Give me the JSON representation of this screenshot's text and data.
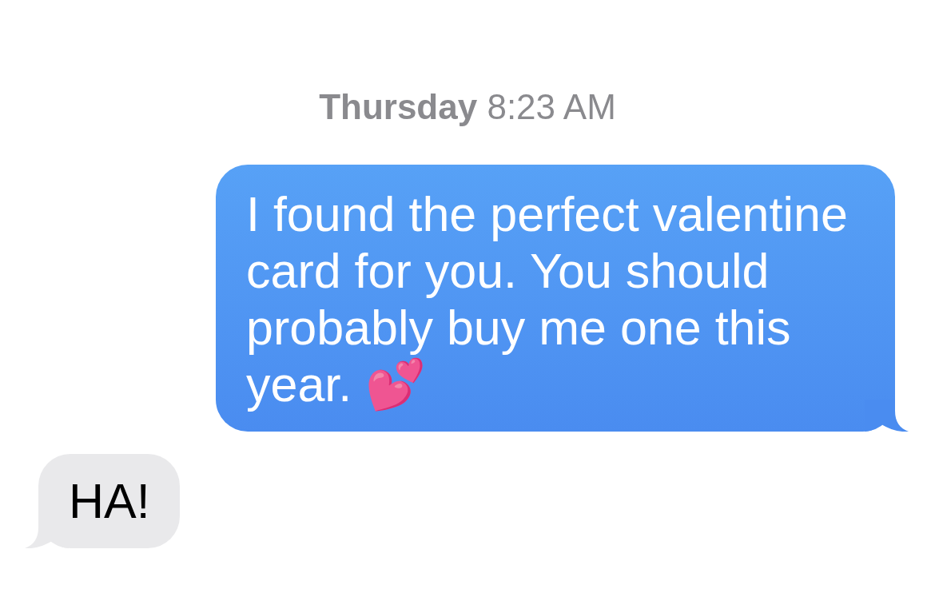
{
  "timestamp": {
    "text": "**Thursday** 8:23 AM"
  },
  "messages": [
    {
      "kind": "sent",
      "text": "I found the perfect valentine card for you. You should probably buy me one this year. 💕"
    },
    {
      "kind": "received",
      "text": "HA!"
    }
  ]
}
